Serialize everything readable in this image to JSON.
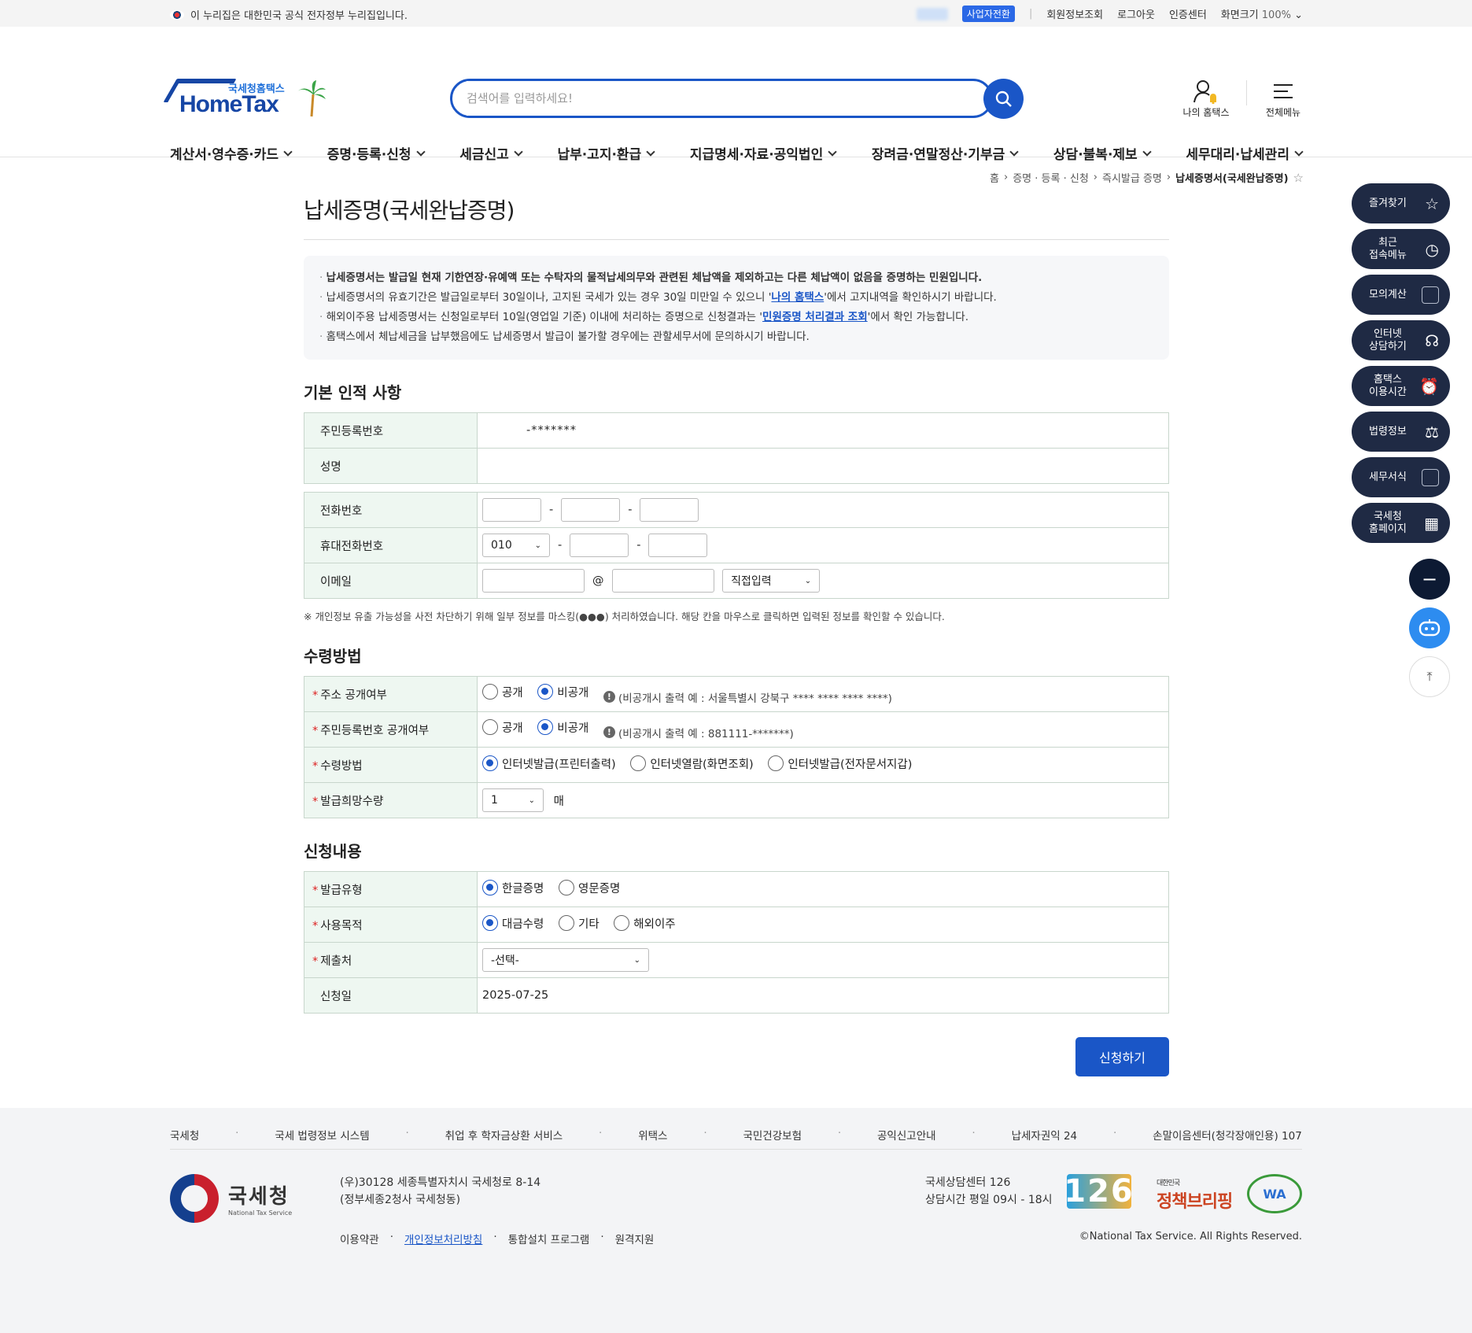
{
  "topbar": {
    "gov_notice": "이 누리집은 대한민국 공식 전자정부 누리집입니다.",
    "biz_switch": "사업자전환",
    "member_info": "회원정보조회",
    "logout": "로그아웃",
    "cert_center": "인증센터",
    "zoom_label": "화면크기",
    "zoom_value": "100%"
  },
  "header": {
    "logo_sub": "국세청홈택스",
    "logo_main": "HomeTax",
    "search_placeholder": "검색어를 입력하세요!",
    "my_hometax": "나의 홈택스",
    "all_menu": "전체메뉴"
  },
  "gnb": [
    "계산서·영수증·카드",
    "증명·등록·신청",
    "세금신고",
    "납부·고지·환급",
    "지급명세·자료·공익법인",
    "장려금·연말정산·기부금",
    "상담·불복·제보",
    "세무대리·납세관리"
  ],
  "breadcrumb": [
    "홈",
    "증명 · 등록 · 신청",
    "즉시발급 증명",
    "납세증명서(국세완납증명)"
  ],
  "page_title": "납세증명(국세완납증명)",
  "notice": {
    "line1": "납세증명서는 발급일 현재 기한연장·유예액 또는 수탁자의 물적납세의무와 관련된 체납액을 제외하고는 다른 체납액이 없음을 증명하는 민원입니다.",
    "line2_pre": "납세증명서의 유효기간은 발급일로부터 30일이나, 고지된 국세가 있는 경우 30일 미만일 수 있으니 '",
    "line2_link": "나의 홈택스",
    "line2_post": "'에서 고지내역을 확인하시기 바랍니다.",
    "line3_pre": "해외이주용 납세증명서는 신청일로부터 10일(영업일 기준) 이내에 처리하는 증명으로 신청결과는 '",
    "line3_link": "민원증명 처리결과 조회",
    "line3_post": "'에서 확인 가능합니다.",
    "line4": "홈택스에서 체납세금을 납부했음에도 납세증명서 발급이 불가할 경우에는 관할세무서에 문의하시기 바랍니다."
  },
  "basic": {
    "heading": "기본 인적 사항",
    "rrn_label": "주민등록번호",
    "rrn_value": "-*******",
    "name_label": "성명",
    "name_value": "",
    "phone_label": "전화번호",
    "mobile_label": "휴대전화번호",
    "mobile_prefix": "010",
    "email_label": "이메일",
    "email_at": "@",
    "email_domain_select": "직접입력",
    "mask_notice": "※ 개인정보 유출 가능성을 사전 차단하기 위해 일부 정보를 마스킹(●●●) 처리하였습니다. 해당 칸을 마우스로 클릭하면 입력된 정보를 확인할 수 있습니다."
  },
  "receive": {
    "heading": "수령방법",
    "addr_label": "주소 공개여부",
    "rrn_label": "주민등록번호 공개여부",
    "opt_public": "공개",
    "opt_private": "비공개",
    "addr_hint": "(비공개시 출력 예 : 서울특별시 강북구 **** **** **** ****)",
    "rrn_hint": "(비공개시 출력 예 : 881111-*******)",
    "method_label": "수령방법",
    "method_opts": [
      "인터넷발급(프린터출력)",
      "인터넷열람(화면조회)",
      "인터넷발급(전자문서지갑)"
    ],
    "qty_label": "발급희망수량",
    "qty_value": "1",
    "qty_unit": "매"
  },
  "apply": {
    "heading": "신청내용",
    "type_label": "발급유형",
    "type_opts": [
      "한글증명",
      "영문증명"
    ],
    "purpose_label": "사용목적",
    "purpose_opts": [
      "대금수령",
      "기타",
      "해외이주"
    ],
    "submit_to_label": "제출처",
    "submit_to_value": "-선택-",
    "date_label": "신청일",
    "date_value": "2025-07-25",
    "submit_button": "신청하기"
  },
  "quick": [
    {
      "l1": "즐겨찾기",
      "l2": ""
    },
    {
      "l1": "최근",
      "l2": "접속메뉴"
    },
    {
      "l1": "모의계산",
      "l2": ""
    },
    {
      "l1": "인터넷",
      "l2": "상담하기"
    },
    {
      "l1": "홈택스",
      "l2": "이용시간"
    },
    {
      "l1": "법령정보",
      "l2": ""
    },
    {
      "l1": "세무서식",
      "l2": ""
    },
    {
      "l1": "국세청",
      "l2": "홈페이지"
    }
  ],
  "footer": {
    "links": [
      "국세청",
      "국세 법령정보 시스템",
      "취업 후 학자금상환 서비스",
      "위택스",
      "국민건강보험",
      "공익신고안내",
      "납세자권익 24",
      "손말이음센터(청각장애인용) 107"
    ],
    "org_name": "국세청",
    "org_eng": "National Tax Service",
    "addr1": "(우)30128 세종특별자치시 국세청로 8-14",
    "addr2": "(정부세종2청사 국세청동)",
    "terms": "이용약관",
    "privacy": "개인정보처리방침",
    "install": "통합설치 프로그램",
    "remote": "원격지원",
    "call_center": "국세상담센터 126",
    "call_hours": "상담시간 평일 09시 - 18시",
    "badge_126": "126",
    "policy_small": "대한민국",
    "policy_main": "정책브리핑",
    "wa": "WA",
    "copyright": "©National Tax Service. All Rights Reserved."
  }
}
